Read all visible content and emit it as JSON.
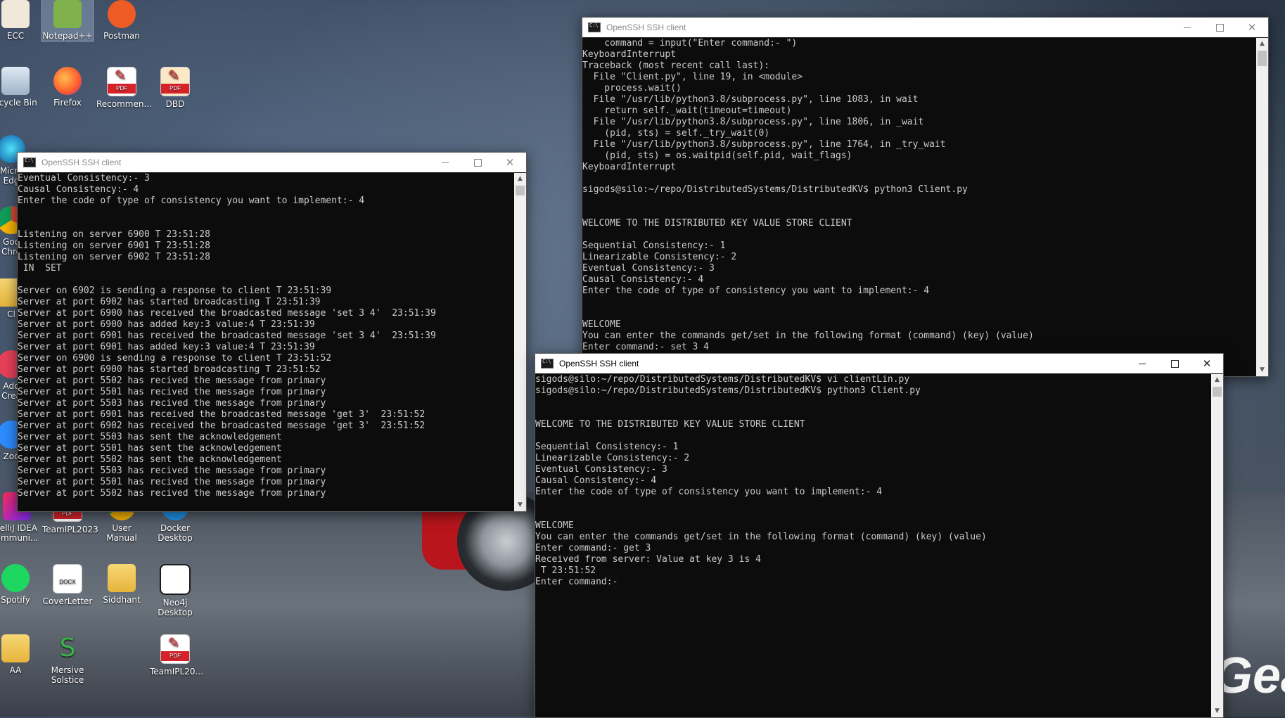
{
  "desktop": {
    "icons": [
      {
        "label": "ECC",
        "icon": "ecc-app-icon"
      },
      {
        "label": "Notepad++",
        "icon": "notepadpp-icon"
      },
      {
        "label": "Postman",
        "icon": "postman-icon"
      },
      {
        "label": "ecycle Bin",
        "icon": "recycle-bin-icon"
      },
      {
        "label": "Firefox",
        "icon": "firefox-icon"
      },
      {
        "label": "Recommen...",
        "icon": "pdf-file-icon"
      },
      {
        "label": "DBD",
        "icon": "pdf-file-icon"
      },
      {
        "label": "Micro\nEdg",
        "icon": "edge-icon"
      },
      {
        "label": "Goo\nChro",
        "icon": "chrome-icon"
      },
      {
        "label": "Cl",
        "icon": "folder-icon"
      },
      {
        "label": "Ado\nCrea",
        "icon": "adobe-creative-icon"
      },
      {
        "label": "Zoo",
        "icon": "zoom-icon"
      },
      {
        "label": "telliJ IDEA\nommuni...",
        "icon": "intellij-icon"
      },
      {
        "label": "TeamIPL2023",
        "icon": "pdf-file-icon"
      },
      {
        "label": "User Manual",
        "icon": "chrome-icon"
      },
      {
        "label": "Docker\nDesktop",
        "icon": "docker-icon"
      },
      {
        "label": "Spotify",
        "icon": "spotify-icon"
      },
      {
        "label": "CoverLetter",
        "icon": "docx-file-icon"
      },
      {
        "label": "Siddhant",
        "icon": "folder-icon"
      },
      {
        "label": "Neo4j\nDesktop",
        "icon": "neo4j-icon"
      },
      {
        "label": "AA",
        "icon": "folder-icon"
      },
      {
        "label": "Mersive\nSolstice",
        "icon": "mersive-icon"
      },
      {
        "label": "TeamIPL20...",
        "icon": "pdf-file-icon"
      }
    ],
    "wallpaper_text": "Gea"
  },
  "windows": {
    "left": {
      "title": "OpenSSH SSH client",
      "lines": [
        "Eventual Consistency:- 3",
        "Causal Consistency:- 4",
        "Enter the code of type of consistency you want to implement:- 4",
        "",
        "",
        "Listening on server 6900 T 23:51:28",
        "Listening on server 6901 T 23:51:28",
        "Listening on server 6902 T 23:51:28",
        " IN  SET",
        "",
        "Server on 6902 is sending a response to client T 23:51:39",
        "Server at port 6902 has started broadcasting T 23:51:39",
        "Server at port 6900 has received the broadcasted message 'set 3 4'  23:51:39",
        "Server at port 6900 has added key:3 value:4 T 23:51:39",
        "Server at port 6901 has received the broadcasted message 'set 3 4'  23:51:39",
        "Server at port 6901 has added key:3 value:4 T 23:51:39",
        "Server on 6900 is sending a response to client T 23:51:52",
        "Server at port 6900 has started broadcasting T 23:51:52",
        "Server at port 5502 has recived the message from primary",
        "Server at port 5501 has recived the message from primary",
        "Server at port 5503 has recived the message from primary",
        "Server at port 6901 has received the broadcasted message 'get 3'  23:51:52",
        "Server at port 6902 has received the broadcasted message 'get 3'  23:51:52",
        "Server at port 5503 has sent the acknowledgement",
        "Server at port 5501 has sent the acknowledgement",
        "Server at port 5502 has sent the acknowledgement",
        "Server at port 5503 has recived the message from primary",
        "Server at port 5501 has recived the message from primary",
        "Server at port 5502 has recived the message from primary"
      ]
    },
    "top_right": {
      "title": "OpenSSH SSH client",
      "lines": [
        "    command = input(\"Enter command:- \")",
        "KeyboardInterrupt",
        "Traceback (most recent call last):",
        "  File \"Client.py\", line 19, in <module>",
        "    process.wait()",
        "  File \"/usr/lib/python3.8/subprocess.py\", line 1083, in wait",
        "    return self._wait(timeout=timeout)",
        "  File \"/usr/lib/python3.8/subprocess.py\", line 1806, in _wait",
        "    (pid, sts) = self._try_wait(0)",
        "  File \"/usr/lib/python3.8/subprocess.py\", line 1764, in _try_wait",
        "    (pid, sts) = os.waitpid(self.pid, wait_flags)",
        "KeyboardInterrupt",
        "",
        "sigods@silo:~/repo/DistributedSystems/DistributedKV$ python3 Client.py",
        "",
        "",
        "WELCOME TO THE DISTRIBUTED KEY VALUE STORE CLIENT",
        "",
        "Sequential Consistency:- 1",
        "Linearizable Consistency:- 2",
        "Eventual Consistency:- 3",
        "Causal Consistency:- 4",
        "Enter the code of type of consistency you want to implement:- 4",
        "",
        "",
        "WELCOME",
        "You can enter the commands get/set in the following format (command) (key) (value)",
        "Enter command:- set 3 4"
      ]
    },
    "bottom_right": {
      "title": "OpenSSH SSH client",
      "lines": [
        "sigods@silo:~/repo/DistributedSystems/DistributedKV$ vi clientLin.py",
        "sigods@silo:~/repo/DistributedSystems/DistributedKV$ python3 Client.py",
        "",
        "",
        "WELCOME TO THE DISTRIBUTED KEY VALUE STORE CLIENT",
        "",
        "Sequential Consistency:- 1",
        "Linearizable Consistency:- 2",
        "Eventual Consistency:- 3",
        "Causal Consistency:- 4",
        "Enter the code of type of consistency you want to implement:- 4",
        "",
        "",
        "WELCOME",
        "You can enter the commands get/set in the following format (command) (key) (value)",
        "Enter command:- get 3",
        "Received from server: Value at key 3 is 4",
        " T 23:51:52",
        "Enter command:-"
      ]
    }
  },
  "colors": {
    "terminal_bg": "#0c0c0c",
    "terminal_fg": "#cccccc",
    "titlebar_bg": "#ffffff"
  }
}
